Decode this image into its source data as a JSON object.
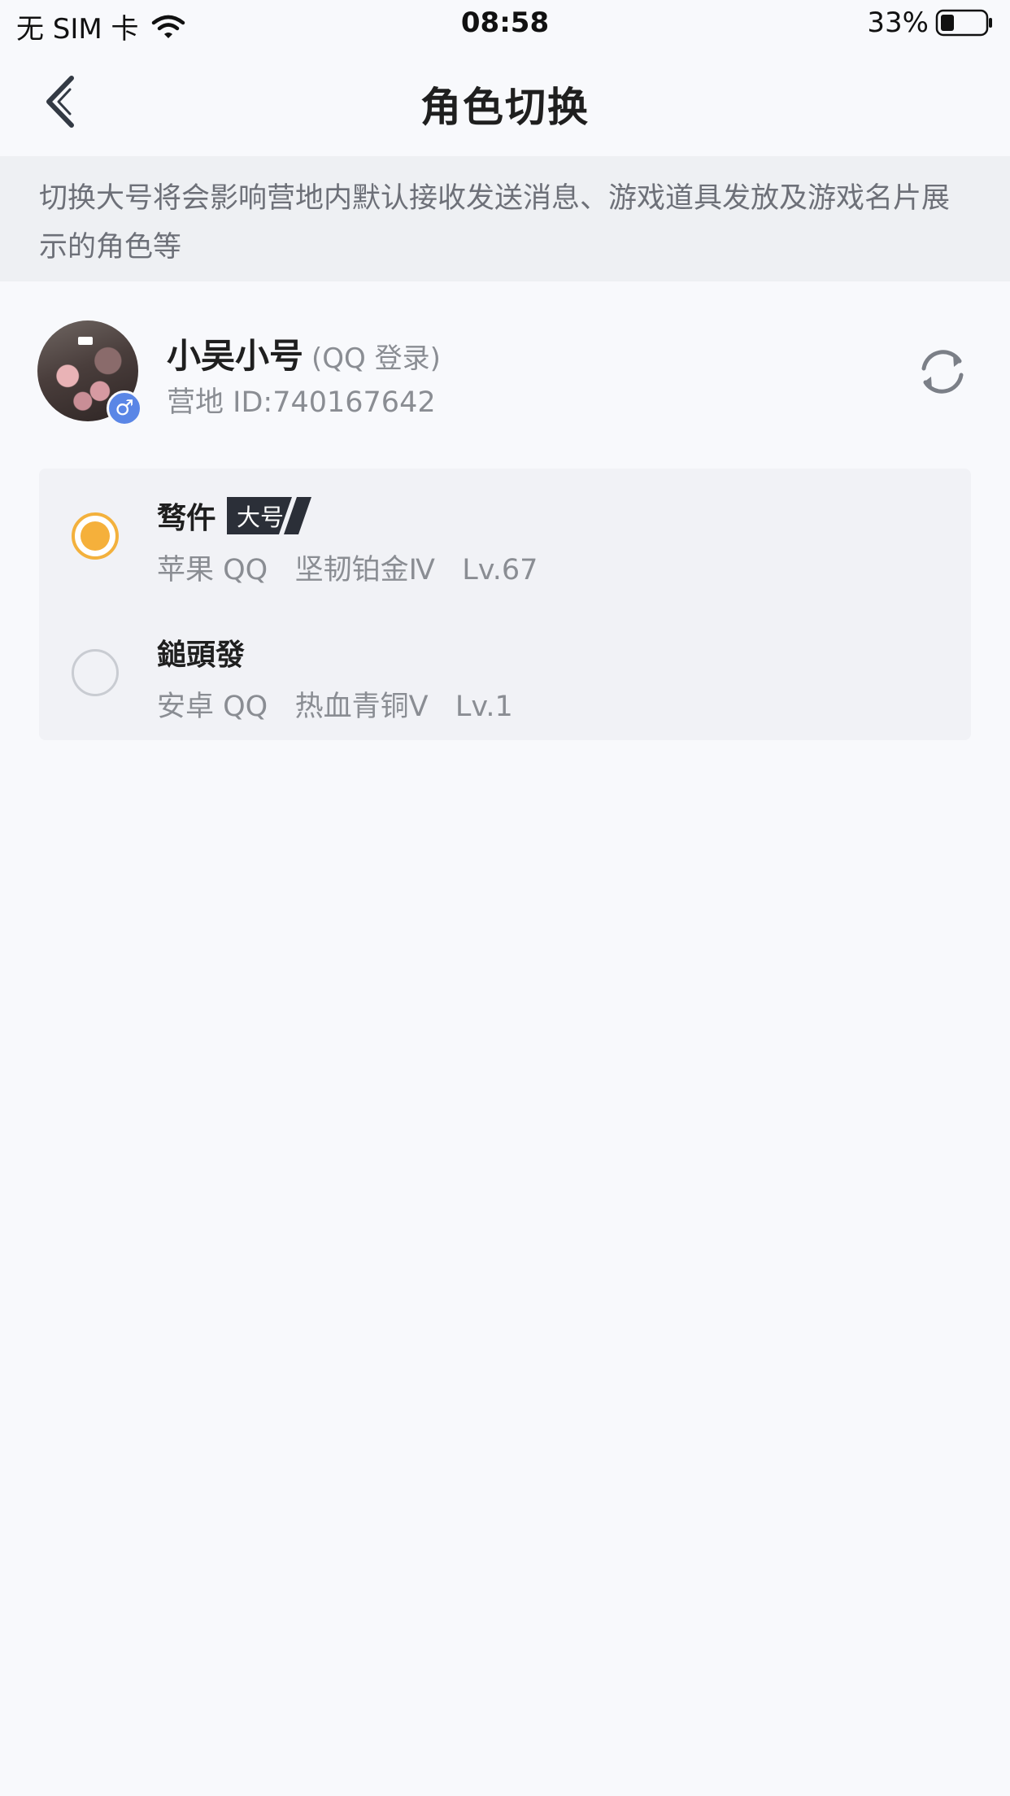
{
  "status_bar": {
    "carrier": "无 SIM 卡",
    "time": "08:58",
    "battery": "33%"
  },
  "nav": {
    "title": "角色切换"
  },
  "notice": {
    "text": "切换大号将会影响营地内默认接收发送消息、游戏道具发放及游戏名片展示的角色等"
  },
  "account": {
    "name": "小吴小号",
    "login_type": "(QQ 登录)",
    "camp_id": "营地 ID:740167642",
    "gender_symbol": "♂"
  },
  "roles": [
    {
      "name": "骛仵",
      "tag": "大号",
      "selected": true,
      "platform": "苹果 QQ",
      "rank": "坚韧铂金Ⅳ",
      "level": "Lv.67",
      "detail": "苹果 QQ   坚韧铂金Ⅳ   Lv.67"
    },
    {
      "name": "鎚頭發",
      "selected": false,
      "platform": "安卓 QQ",
      "rank": "热血青铜Ⅴ",
      "level": "Lv.1",
      "detail": "安卓 QQ   热血青铜Ⅴ   Lv.1"
    }
  ],
  "colors": {
    "accent": "#f5b03b",
    "background": "#f8f9fc",
    "notice_bg": "#eef0f3",
    "tag_bg": "#2b2f38",
    "gender_badge": "#5a86e6"
  }
}
